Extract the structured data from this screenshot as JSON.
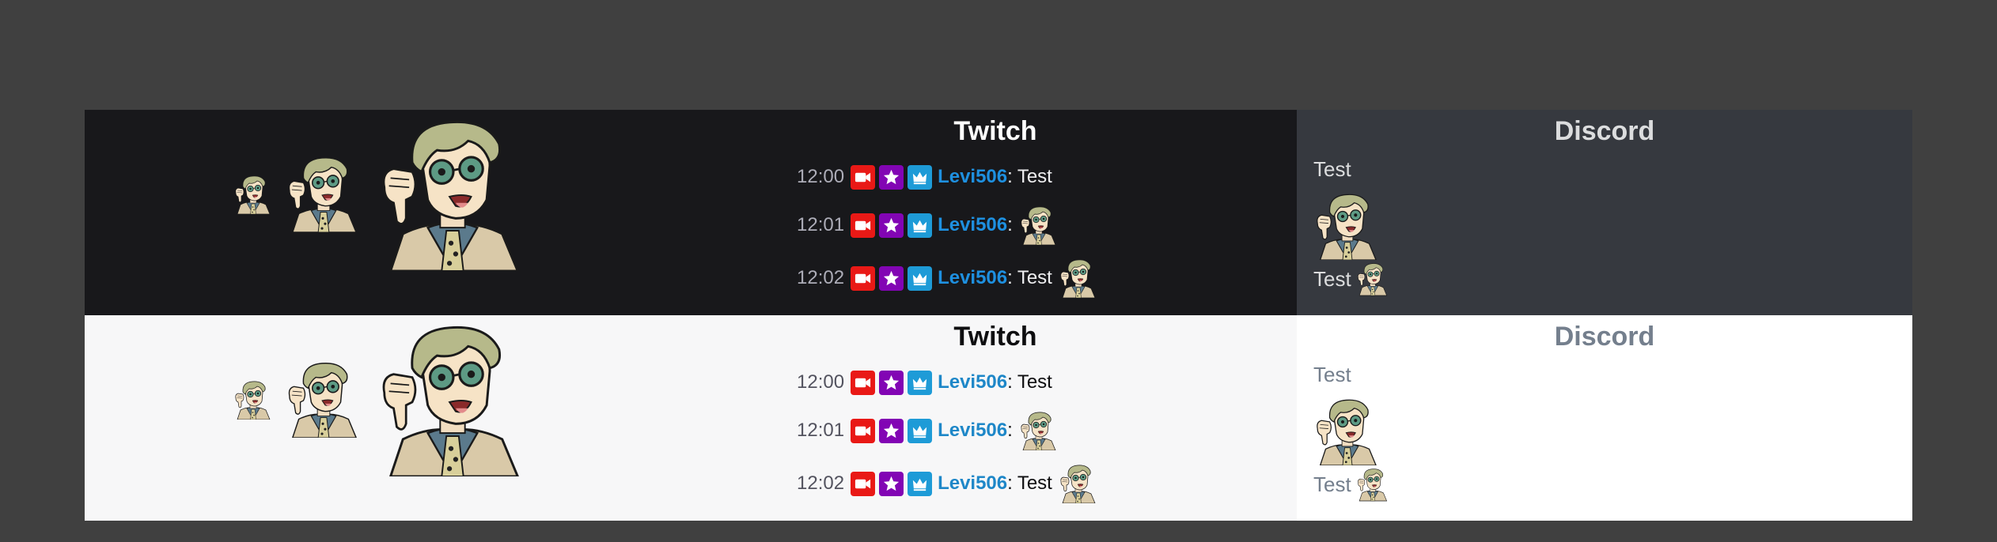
{
  "panes": {
    "twitch_title": "Twitch",
    "discord_title": "Discord"
  },
  "emote_name": "thinking-thumbs-down-emote",
  "colors": {
    "page_bg": "#404040",
    "twitch_dark_bg": "#18181b",
    "twitch_light_bg": "#f7f7f8",
    "discord_dark_bg": "#36393f",
    "discord_light_bg": "#ffffff",
    "username": "#1e90e0",
    "broadcaster_badge": "#e91916",
    "vip_badge": "#8205b4",
    "subscriber_badge": "#1e9bd7"
  },
  "chat": {
    "lines": [
      {
        "time": "12:00",
        "user": "Levi506",
        "sep": ":",
        "text": "Test",
        "emote": false
      },
      {
        "time": "12:01",
        "user": "Levi506",
        "sep": ":",
        "text": "",
        "emote": true
      },
      {
        "time": "12:02",
        "user": "Levi506",
        "sep": ":",
        "text": "Test",
        "emote": true
      }
    ],
    "badges": [
      "video-camera-icon",
      "star-icon",
      "crown-icon"
    ]
  },
  "discord": {
    "line1": "Test",
    "line3": "Test"
  }
}
